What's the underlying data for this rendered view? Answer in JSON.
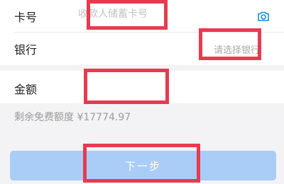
{
  "form": {
    "card_label": "卡号",
    "card_placeholder": "收款人储蓄卡号",
    "camera_icon": "camera-icon",
    "bank_label": "银行",
    "bank_placeholder": "请选择银行",
    "amount_label": "金额",
    "amount_value": "",
    "quota_text": "剩余免费额度 ¥17774.97",
    "next_label": "下一步"
  },
  "colors": {
    "accent": "#1b8ad4",
    "button_disabled": "#a9cdf6",
    "redaction": "#e63b50"
  }
}
